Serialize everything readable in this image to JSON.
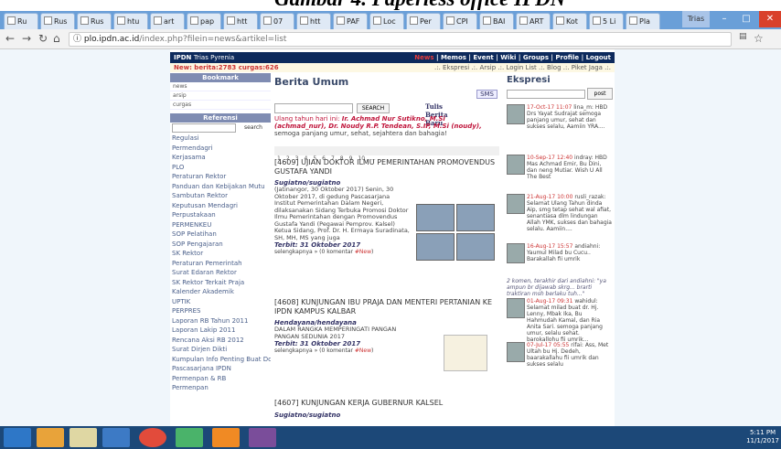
{
  "doc_heading": "Gambar 4. Paperless office IPDN",
  "browser": {
    "tabs": [
      "Ru",
      "Rus",
      "Rus",
      "htu",
      "art",
      "pap",
      "htt",
      "07",
      "htt",
      "PAF",
      "Loc",
      "Per",
      "CPI",
      "BAI",
      "ART",
      "Kot",
      "5 Li",
      "Pla"
    ],
    "user": "Trias",
    "url_host": "plo.ipdn.ac.id",
    "url_path": "/index.php?filein=news&artikel=list"
  },
  "site": {
    "logo": "IPDN",
    "logo_sub": "Trias Pyrenia",
    "news_label": "News",
    "menu": "| Memos | Event | Wiki | Groups | Profile | Logout",
    "counter": "New: berita:2783 curgas:626",
    "sublinks": ".:. Ekspresi .:. Arsip .:. Login List .:. Blog .:. Piket Jaga .:."
  },
  "left": {
    "bookmark_title": "Bookmark",
    "bookmark_items": [
      "news",
      "arsip",
      "curgas"
    ],
    "referensi_title": "Referensi",
    "search_label": "search",
    "items": [
      "Regulasi",
      "Permendagri",
      "Kerjasama",
      "PLO",
      "Peraturan Rektor",
      "Panduan dan Kebijakan Mutu",
      "Sambutan Rektor",
      "Keputusan Mendagri",
      "Perpustakaan",
      "PERMENKEU",
      "SOP Pelatihan",
      "SOP Pengajaran",
      "SK Rektor",
      "Peraturan Pemerintah",
      "Surat Edaran Rektor",
      "SK Rektor Terkait Praja",
      "Kalender Akademik",
      "UPTIK",
      "PERPRES",
      "Laporan RB Tahun 2011",
      "Laporan Lakip 2011",
      "Rencana Aksi RB 2012",
      "Surat Dirjen Dikti",
      "Kumpulan Info Penting Buat Dosen",
      "Pascasarjana IPDN",
      "Permenpan & RB",
      "Permenpan"
    ]
  },
  "center": {
    "title": "Berita Umum",
    "sms": "SMS",
    "search_btn": "SEARCH",
    "tulis": "Tulis Berita Baru",
    "ultah_prefix": "Ulang tahun hari ini: ",
    "ultah_names": "Ir. Achmad Nur Sutikno, M.Si (achmad_nur), Dr. Noudy R.P. Tendean, S.IP, M.Si (noudy),",
    "ultah_wish": "semoga panjang umur, sehat, sejahtera dan bahagia!",
    "pages": [
      "1",
      "2",
      "3",
      "4",
      "5",
      "6",
      "7",
      "8",
      "9",
      "10",
      "..."
    ],
    "articles": [
      {
        "title": "[4609] UJIAN DOKTOR ILMU PEMERINTAHAN PROMOVENDUS GUSTAFA YANDI",
        "author": "Sugiatno/sugiatno",
        "body": "(Jatinangor, 30 Oktober 2017) Senin, 30 Oktober 2017, di gedung Pascasarjana Institut Pemerintahan Dalam Negeri, dilaksanakan Sidang Terbuka Promosi Doktor Ilmu Pemerintahan dengan Promovendus Gustafa Yandi (Pegawai Pemprov. Kalsel) Ketua Sidang, Prof. Dr. H. Ermaya Suradinata, SH, MH, MS yang juga",
        "date": "Terbit: 31 Oktober 2017",
        "more": "selengkapnya » (0 komentar ",
        "new": "#New"
      },
      {
        "title": "[4608] KUNJUNGAN IBU PRAJA DAN MENTERI PERTANIAN KE IPDN KAMPUS KALBAR",
        "author": "Hendayana/hendayana",
        "body": "DALAM RANGKA MEMPERINGATI PANGAN PANGAN SEDUNIA 2017",
        "date": "Terbit: 31 Oktober 2017",
        "more": "selengkapnya » (0 komentar ",
        "new": "#New"
      },
      {
        "title": "[4607] KUNJUNGAN KERJA GUBERNUR KALSEL",
        "author": "Sugiatno/sugiatno",
        "body": "",
        "date": "",
        "more": "",
        "new": ""
      }
    ]
  },
  "right": {
    "title": "Ekspresi",
    "post": "post",
    "entries": [
      {
        "head": "17-Oct-17 11:07",
        "text": "lina_m: HBD Drs Yayat Sudrajat semoga panjang umur, sehat dan sukses selalu, Aamiin YRA...."
      },
      {
        "head": "10-Sep-17 12:40",
        "text": "indray: HBD Mas Achmad Emir, Bu Dini, dan neng Mutiar. Wish U All The Best"
      },
      {
        "head": "21-Aug-17 10:00",
        "text": "rusli_razak: Selamat Ulang Tahun dinda Aip, smg tetap sehat wal afiat, senantiasa dlm lindungan Allah YMK, sukses dan bahagia selalu. Aamiin...."
      },
      {
        "head": "16-Aug-17 15:57",
        "text": "andiahni: Yaumul Milad bu Cucu.. Barakallah fii umrik"
      },
      {
        "head": "",
        "text": "2 komen, terakhir dari andiahni: \"ya ampun br dijawab skrg... brarti traktiran msh berlaku tuh...\""
      },
      {
        "head": "01-Aug-17 09:31",
        "text": "wahidul: Selamat milad buat dr. Hj. Lenny, Mbak Ika, Bu Hahmudah Kamal, dan Ria Anita Sari. semoga panjang umur, selalu sehat. barokallohu fii umrik..."
      },
      {
        "head": "07-Jul-17 05:55",
        "text": "rifai: Ass, Met Ultah bu Hj. Dedeh, baarakallahu fii umrik dan sukses selalu"
      }
    ]
  },
  "taskbar": {
    "time": "5:11 PM",
    "date": "11/1/2017"
  }
}
